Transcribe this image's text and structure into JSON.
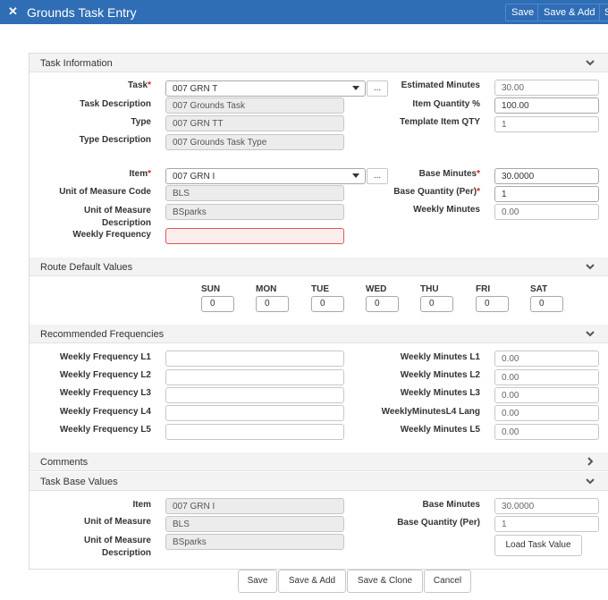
{
  "window": {
    "title": "Grounds Task Entry",
    "top_save": "Save",
    "top_save_add": "Save & Add",
    "top_clip": "S"
  },
  "task_information": {
    "section_title": "Task Information",
    "task_label": "Task",
    "task_value": "007 GRN T",
    "dots": "...",
    "task_desc_label": "Task Description",
    "task_desc_value": "007 Grounds Task",
    "type_label": "Type",
    "type_value": "007 GRN TT",
    "type_desc_label": "Type Description",
    "type_desc_value": "007 Grounds Task Type",
    "est_min_label": "Estimated Minutes",
    "est_min_value": "30.00",
    "item_qty_label": "Item Quantity %",
    "item_qty_value": "100.00",
    "tmpl_qty_label": "Template Item QTY",
    "tmpl_qty_value": "1",
    "item_label": "Item",
    "item_value": "007 GRN I",
    "uom_code_label": "Unit of Measure Code",
    "uom_code_value": "BLS",
    "uom_desc_label_1": "Unit of Measure",
    "uom_desc_label_2": "Description",
    "uom_desc_value": "BSparks",
    "weekly_freq_label": "Weekly Frequency",
    "weekly_freq_value": "",
    "base_min_label": "Base Minutes",
    "base_min_value": "30.0000",
    "base_qty_label": "Base Quantity (Per)",
    "base_qty_value": "1",
    "weekly_min_label": "Weekly Minutes",
    "weekly_min_value": "0.00"
  },
  "route_defaults": {
    "section_title": "Route Default Values",
    "days": [
      {
        "label": "SUN",
        "value": "0"
      },
      {
        "label": "MON",
        "value": "0"
      },
      {
        "label": "TUE",
        "value": "0"
      },
      {
        "label": "WED",
        "value": "0"
      },
      {
        "label": "THU",
        "value": "0"
      },
      {
        "label": "FRI",
        "value": "0"
      },
      {
        "label": "SAT",
        "value": "0"
      }
    ]
  },
  "recommended": {
    "section_title": "Recommended Frequencies",
    "freq_labels": [
      "Weekly Frequency L1",
      "Weekly Frequency L2",
      "Weekly Frequency L3",
      "Weekly Frequency L4",
      "Weekly Frequency L5"
    ],
    "freq_values": [
      "",
      "",
      "",
      "",
      ""
    ],
    "min_labels": [
      "Weekly Minutes L1",
      "Weekly Minutes L2",
      "Weekly Minutes L3",
      "WeeklyMinutesL4 Lang",
      "Weekly Minutes L5"
    ],
    "min_values": [
      "0.00",
      "0.00",
      "0.00",
      "0.00",
      "0.00"
    ]
  },
  "comments": {
    "section_title": "Comments"
  },
  "base_values": {
    "section_title": "Task Base Values",
    "item_label": "Item",
    "item_value": "007 GRN I",
    "uom_label": "Unit of Measure",
    "uom_value": "BLS",
    "uom_desc_label_1": "Unit of Measure",
    "uom_desc_label_2": "Description",
    "uom_desc_value": "BSparks",
    "base_min_label": "Base Minutes",
    "base_min_value": "30.0000",
    "base_qty_label": "Base Quantity (Per)",
    "base_qty_value": "1",
    "load_button": "Load Task Value"
  },
  "footer": {
    "save": "Save",
    "save_add": "Save & Add",
    "save_clone": "Save & Clone",
    "cancel": "Cancel"
  }
}
